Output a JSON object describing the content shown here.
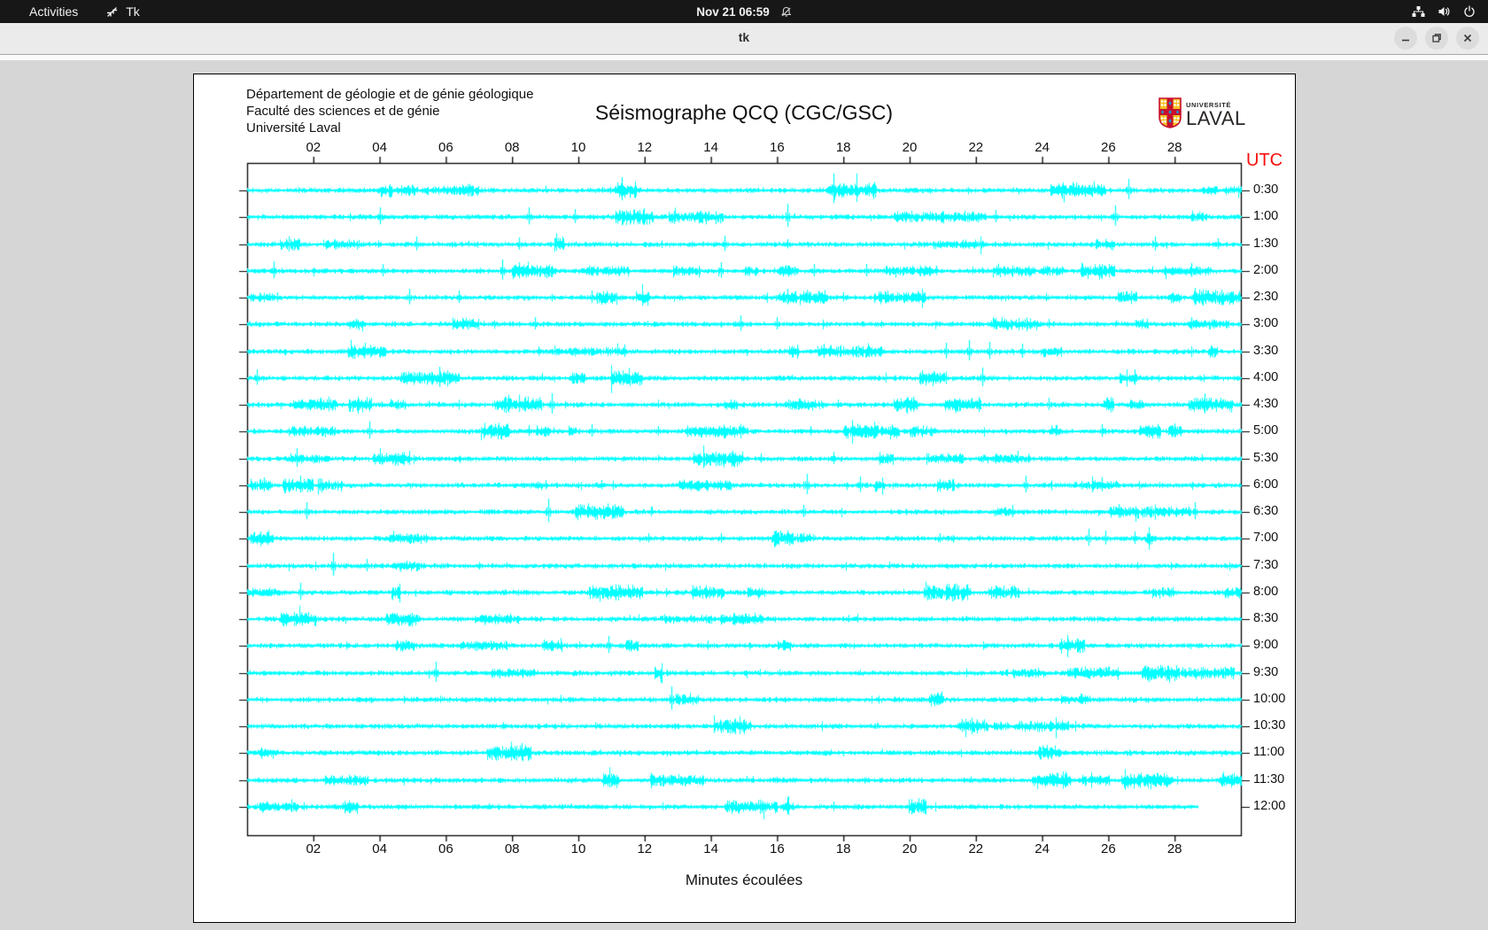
{
  "topbar": {
    "activities": "Activities",
    "app_name": "Tk",
    "clock": "Nov 21 06:59"
  },
  "window": {
    "title": "tk",
    "controls": [
      "minimize",
      "maximize",
      "close"
    ]
  },
  "header": {
    "dept_lines": [
      "Département de géologie et de génie géologique",
      "Faculté des sciences et de génie",
      "Université Laval"
    ]
  },
  "logo": {
    "line1": "UNIVERSITÉ",
    "line2": "LAVAL"
  },
  "colors": {
    "topbar_bg": "#171717",
    "titlebar_bg": "#ebebeb",
    "desktop_bg": "#d6d6d6",
    "canvas_bg": "#ffffff",
    "trace": "#00ffff",
    "utc_label": "#fb0d0d",
    "axis": "#000000"
  },
  "chart_data": {
    "type": "line",
    "title": "Séismographe QCQ (CGC/GSC)",
    "xlabel": "Minutes écoulées",
    "right_axis_label": "UTC",
    "x_range": [
      0,
      30
    ],
    "x_ticks": [
      "02",
      "04",
      "06",
      "08",
      "10",
      "12",
      "14",
      "16",
      "18",
      "20",
      "22",
      "24",
      "26",
      "28"
    ],
    "trace_color": "#00ffff",
    "last_row_end_minute": 28.7,
    "rows": [
      {
        "label": "0:30",
        "spikes": [
          [
            6.6,
            5
          ],
          [
            11.3,
            15
          ],
          [
            17.7,
            19
          ],
          [
            26.6,
            13
          ]
        ],
        "bursts": [
          [
            6.2,
            7.0,
            2.2
          ]
        ]
      },
      {
        "label": "1:00",
        "spikes": [
          [
            4.0,
            11
          ],
          [
            8.5,
            11
          ],
          [
            9.9,
            9
          ],
          [
            16.3,
            15
          ],
          [
            19.9,
            6
          ],
          [
            21.0,
            7
          ],
          [
            22.6,
            8
          ],
          [
            26.2,
            13
          ]
        ],
        "bursts": [
          [
            19.5,
            22.3,
            2.0
          ]
        ]
      },
      {
        "label": "1:30",
        "spikes": [
          [
            1.3,
            6
          ],
          [
            5.1,
            9
          ],
          [
            8.2,
            8
          ],
          [
            14.4,
            10
          ],
          [
            16.3,
            6
          ],
          [
            27.4,
            9
          ],
          [
            29.3,
            7
          ]
        ],
        "bursts": [
          [
            1.0,
            1.6,
            2.2
          ],
          [
            25.6,
            26.2,
            2.0
          ]
        ]
      },
      {
        "label": "2:00",
        "spikes": [
          [
            0.8,
            11
          ],
          [
            4.1,
            8
          ],
          [
            7.7,
            13
          ],
          [
            14.3,
            10
          ],
          [
            16.3,
            6
          ],
          [
            17.1,
            8
          ],
          [
            18.7,
            8
          ],
          [
            20.8,
            6
          ],
          [
            28.5,
            9
          ]
        ],
        "bursts": [
          [
            16.0,
            16.6,
            2.0
          ]
        ]
      },
      {
        "label": "2:30",
        "spikes": [
          [
            0.9,
            6
          ],
          [
            4.9,
            10
          ],
          [
            6.4,
            8
          ],
          [
            10.4,
            8
          ],
          [
            16.3,
            10
          ],
          [
            18.0,
            6
          ],
          [
            28.6,
            11
          ]
        ],
        "bursts": [
          [
            16.0,
            16.6,
            2.0
          ],
          [
            27.8,
            28.2,
            2.2
          ]
        ]
      },
      {
        "label": "3:00",
        "spikes": [
          [
            3.3,
            6
          ],
          [
            6.5,
            7
          ],
          [
            8.7,
            8
          ],
          [
            14.9,
            10
          ],
          [
            16.0,
            8
          ],
          [
            24.2,
            6
          ],
          [
            28.5,
            8
          ]
        ],
        "bursts": [
          [
            6.2,
            7.0,
            2.2
          ],
          [
            3.1,
            3.5,
            2.0
          ],
          [
            26.8,
            27.2,
            2.0
          ]
        ]
      },
      {
        "label": "3:30",
        "spikes": [
          [
            8.8,
            6
          ],
          [
            11.4,
            8
          ],
          [
            17.4,
            9
          ],
          [
            21.1,
            10
          ],
          [
            21.8,
            13
          ],
          [
            22.4,
            11
          ],
          [
            23.4,
            9
          ],
          [
            29.1,
            7
          ]
        ],
        "bursts": [
          [
            17.2,
            17.6,
            2.0
          ],
          [
            29.0,
            29.3,
            2.0
          ]
        ]
      },
      {
        "label": "4:00",
        "spikes": [
          [
            0.3,
            10
          ],
          [
            5.2,
            7
          ],
          [
            5.8,
            13
          ],
          [
            22.2,
            12
          ],
          [
            26.8,
            10
          ]
        ],
        "bursts": [
          [
            4.6,
            6.4,
            2.6
          ]
        ]
      },
      {
        "label": "4:30",
        "spikes": [
          [
            2.5,
            6
          ],
          [
            9.2,
            13
          ],
          [
            14.6,
            6
          ],
          [
            24.2,
            8
          ],
          [
            28.9,
            13
          ]
        ],
        "bursts": [
          [
            2.3,
            2.7,
            2.0
          ],
          [
            14.4,
            14.8,
            2.0
          ]
        ]
      },
      {
        "label": "5:00",
        "spikes": [
          [
            1.4,
            5
          ],
          [
            3.7,
            11
          ],
          [
            8.5,
            7
          ],
          [
            10.4,
            8
          ],
          [
            12.4,
            6
          ],
          [
            17.0,
            6
          ],
          [
            19.0,
            7
          ],
          [
            24.4,
            7
          ],
          [
            25.8,
            8
          ],
          [
            28.0,
            9
          ]
        ],
        "bursts": [
          [
            8.7,
            9.1,
            2.0
          ],
          [
            13.2,
            13.6,
            2.0
          ],
          [
            19.0,
            19.4,
            2.0
          ],
          [
            24.2,
            24.6,
            2.0
          ],
          [
            27.8,
            28.2,
            2.2
          ]
        ]
      },
      {
        "label": "5:30",
        "spikes": [
          [
            1.5,
            12
          ],
          [
            15.5,
            6
          ],
          [
            17.7,
            8
          ],
          [
            19.3,
            6
          ]
        ],
        "bursts": [
          [
            1.3,
            1.7,
            2.2
          ],
          [
            19.1,
            19.5,
            2.0
          ]
        ]
      },
      {
        "label": "6:00",
        "spikes": [
          [
            0.5,
            9
          ],
          [
            1.6,
            11
          ],
          [
            2.2,
            8
          ],
          [
            9.0,
            6
          ],
          [
            10.7,
            6
          ],
          [
            16.9,
            13
          ],
          [
            18.5,
            10
          ],
          [
            23.5,
            11
          ],
          [
            25.8,
            9
          ]
        ],
        "bursts": [
          [
            0.1,
            0.7,
            2.2
          ]
        ]
      },
      {
        "label": "6:30",
        "spikes": [
          [
            1.8,
            11
          ],
          [
            9.1,
            15
          ],
          [
            12.2,
            6
          ],
          [
            16.8,
            8
          ],
          [
            23.1,
            8
          ],
          [
            26.3,
            9
          ],
          [
            28.6,
            11
          ]
        ],
        "bursts": [
          [
            26.0,
            26.9,
            2.2
          ]
        ]
      },
      {
        "label": "7:00",
        "spikes": [
          [
            0.4,
            8
          ],
          [
            12.1,
            6
          ],
          [
            14.3,
            6
          ],
          [
            16.8,
            6
          ],
          [
            20.9,
            6
          ],
          [
            25.4,
            11
          ],
          [
            25.9,
            9
          ],
          [
            26.8,
            8
          ]
        ],
        "bursts": [
          [
            0.1,
            0.8,
            2.6
          ],
          [
            16.6,
            17.0,
            2.0
          ]
        ]
      },
      {
        "label": "7:30",
        "spikes": [
          [
            2.6,
            15
          ],
          [
            3.6,
            8
          ],
          [
            4.8,
            6
          ]
        ],
        "bursts": [
          [
            4.4,
            5.2,
            2.0
          ]
        ]
      },
      {
        "label": "8:00",
        "spikes": [
          [
            1.6,
            11
          ]
        ],
        "bursts": []
      },
      {
        "label": "8:30",
        "spikes": [
          [
            5.2,
            4
          ]
        ],
        "bursts": []
      },
      {
        "label": "9:00",
        "spikes": [
          [
            9.2,
            6
          ],
          [
            10.9,
            11
          ],
          [
            11.6,
            6
          ],
          [
            13.9,
            6
          ],
          [
            16.2,
            6
          ]
        ],
        "bursts": [
          [
            8.9,
            9.5,
            2.2
          ],
          [
            11.4,
            11.8,
            2.0
          ],
          [
            16.0,
            16.4,
            2.0
          ]
        ]
      },
      {
        "label": "9:30",
        "spikes": [
          [
            5.7,
            13
          ]
        ],
        "bursts": []
      },
      {
        "label": "10:00",
        "spikes": [
          [
            12.8,
            15
          ]
        ],
        "bursts": []
      },
      {
        "label": "10:30",
        "spikes": [],
        "bursts": []
      },
      {
        "label": "11:00",
        "spikes": [
          [
            8.3,
            11
          ]
        ],
        "bursts": []
      },
      {
        "label": "11:30",
        "spikes": [],
        "bursts": []
      },
      {
        "label": "12:00",
        "spikes": [
          [
            1.7,
            5
          ],
          [
            7.3,
            4
          ],
          [
            16.3,
            11
          ],
          [
            17.7,
            6
          ]
        ],
        "bursts": [
          [
            16.1,
            16.5,
            2.0
          ]
        ]
      }
    ]
  }
}
